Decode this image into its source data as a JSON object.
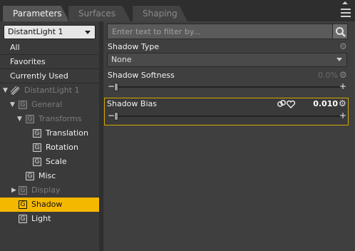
{
  "tabs": [
    {
      "label": "Parameters",
      "active": true
    },
    {
      "label": "Surfaces",
      "active": false
    },
    {
      "label": "Shaping",
      "active": false
    }
  ],
  "left_panel": {
    "node_select": "DistantLight 1",
    "filters": [
      "All",
      "Favorites",
      "Currently Used"
    ],
    "tree": [
      {
        "label": "DistantLight 1",
        "icon": "light-icon",
        "expanded": true,
        "dim": true
      },
      {
        "label": "General",
        "icon": "group-icon",
        "expanded": true,
        "dim": true
      },
      {
        "label": "Transforms",
        "icon": "group-icon",
        "expanded": true,
        "dim": true
      },
      {
        "label": "Translation",
        "icon": "group-icon"
      },
      {
        "label": "Rotation",
        "icon": "group-icon"
      },
      {
        "label": "Scale",
        "icon": "group-icon"
      },
      {
        "label": "Misc",
        "icon": "group-icon"
      },
      {
        "label": "Display",
        "icon": "group-icon",
        "expanded": false,
        "dim": true
      },
      {
        "label": "Shadow",
        "icon": "group-icon",
        "selected": true
      },
      {
        "label": "Light",
        "icon": "group-icon"
      }
    ]
  },
  "right_panel": {
    "filter_placeholder": "Enter text to filter by...",
    "shadow_type": {
      "label": "Shadow Type",
      "value": "None"
    },
    "shadow_softness": {
      "label": "Shadow Softness",
      "value": "0.0%",
      "level": 0.0
    },
    "shadow_bias": {
      "label": "Shadow Bias",
      "value": "0.010",
      "level": 0.0
    }
  },
  "colors": {
    "accent": "#f5b800",
    "selection_border": "#d4a800"
  }
}
